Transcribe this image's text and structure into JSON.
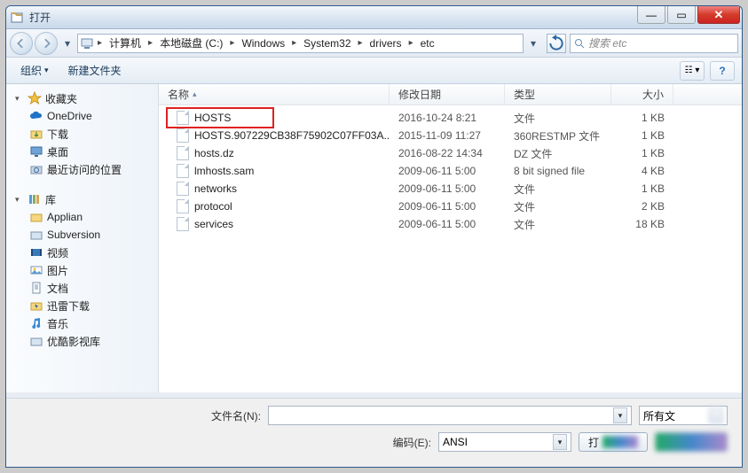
{
  "title": "打开",
  "nav": {
    "breadcrumb": [
      "计算机",
      "本地磁盘 (C:)",
      "Windows",
      "System32",
      "drivers",
      "etc"
    ],
    "search_placeholder": "搜索 etc"
  },
  "toolbar": {
    "organize": "组织",
    "newfolder": "新建文件夹"
  },
  "sidebar": {
    "favorites": {
      "label": "收藏夹",
      "items": [
        {
          "label": "OneDrive",
          "icon": "cloud"
        },
        {
          "label": "下载",
          "icon": "download"
        },
        {
          "label": "桌面",
          "icon": "desktop"
        },
        {
          "label": "最近访问的位置",
          "icon": "recent"
        }
      ]
    },
    "libraries": {
      "label": "库",
      "items": [
        {
          "label": "Applian",
          "icon": "folder"
        },
        {
          "label": "Subversion",
          "icon": "svn"
        },
        {
          "label": "视频",
          "icon": "video"
        },
        {
          "label": "图片",
          "icon": "picture"
        },
        {
          "label": "文档",
          "icon": "document"
        },
        {
          "label": "迅雷下载",
          "icon": "thunder"
        },
        {
          "label": "音乐",
          "icon": "music"
        },
        {
          "label": "优酷影视库",
          "icon": "youku"
        }
      ]
    }
  },
  "columns": {
    "name": "名称",
    "date": "修改日期",
    "type": "类型",
    "size": "大小"
  },
  "files": [
    {
      "name": "HOSTS",
      "date": "2016-10-24 8:21",
      "type": "文件",
      "size": "1 KB",
      "highlight": true
    },
    {
      "name": "HOSTS.907229CB38F75902C07FF03A...",
      "date": "2015-11-09 11:27",
      "type": "360RESTMP 文件",
      "size": "1 KB"
    },
    {
      "name": "hosts.dz",
      "date": "2016-08-22 14:34",
      "type": "DZ 文件",
      "size": "1 KB"
    },
    {
      "name": "lmhosts.sam",
      "date": "2009-06-11 5:00",
      "type": "8 bit signed file",
      "size": "4 KB"
    },
    {
      "name": "networks",
      "date": "2009-06-11 5:00",
      "type": "文件",
      "size": "1 KB"
    },
    {
      "name": "protocol",
      "date": "2009-06-11 5:00",
      "type": "文件",
      "size": "2 KB"
    },
    {
      "name": "services",
      "date": "2009-06-11 5:00",
      "type": "文件",
      "size": "18 KB"
    }
  ],
  "bottom": {
    "filename_label": "文件名(N):",
    "filetype_label": "所有文",
    "encoding_label": "编码(E):",
    "encoding_value": "ANSI",
    "open_label": "打"
  },
  "colors": {
    "highlight": "#e02020"
  }
}
